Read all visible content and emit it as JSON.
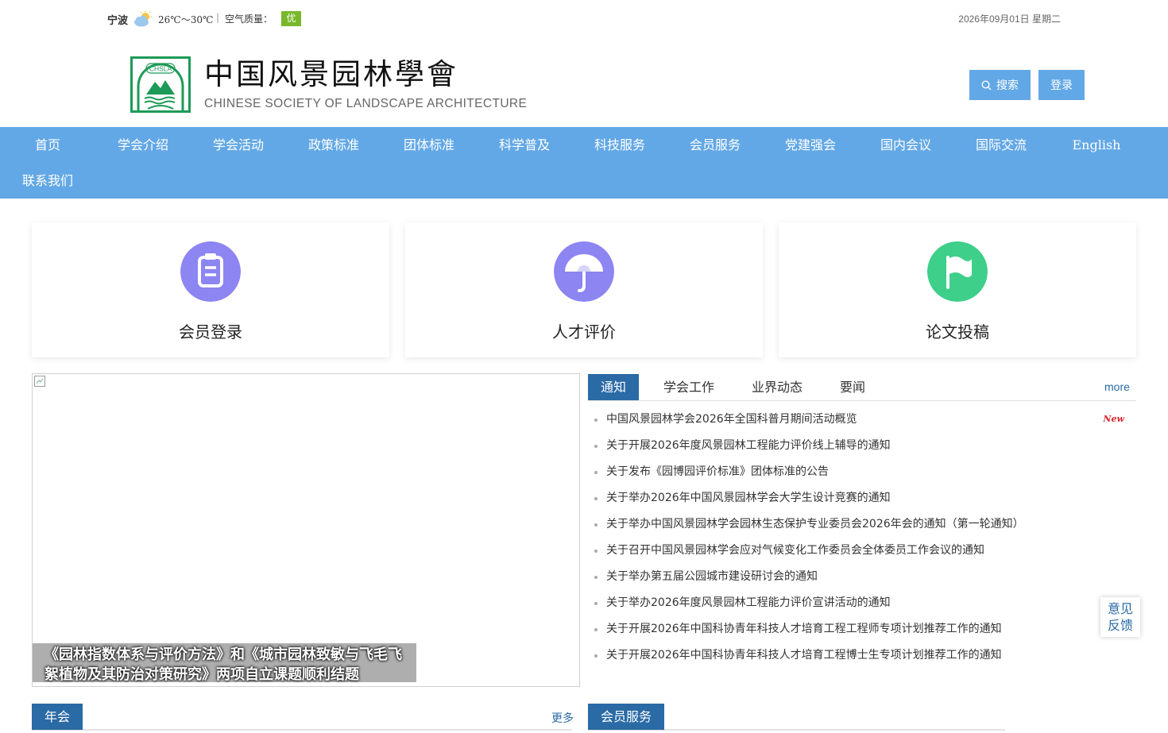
{
  "topbar": {
    "city": "宁波",
    "temperature": "26℃～30℃",
    "separator": "|",
    "air_quality_label": "空气质量：",
    "air_quality_value": "优",
    "date": "2026年09月01日 星期二",
    "weather_icon": "partly-cloudy-icon"
  },
  "header": {
    "logo_cn": "中国风景园林學會",
    "logo_en": "CHINESE SOCIETY OF LANDSCAPE ARCHITECTURE",
    "emblem_text": "CHSLA",
    "search_label": "搜索",
    "login_label": "登录"
  },
  "nav": {
    "items": [
      {
        "label": "首页"
      },
      {
        "label": "学会介绍"
      },
      {
        "label": "学会活动"
      },
      {
        "label": "政策标准"
      },
      {
        "label": "团体标准"
      },
      {
        "label": "科学普及"
      },
      {
        "label": "科技服务"
      },
      {
        "label": "会员服务"
      },
      {
        "label": "党建强会"
      },
      {
        "label": "国内会议"
      },
      {
        "label": "国际交流"
      },
      {
        "label": "English"
      },
      {
        "label": "联系我们"
      }
    ]
  },
  "cards": [
    {
      "label": "会员登录",
      "icon": "clipboard-icon",
      "color": "#8c85f2"
    },
    {
      "label": "人才评价",
      "icon": "umbrella-icon",
      "color": "#8c85f2"
    },
    {
      "label": "论文投稿",
      "icon": "flag-icon",
      "color": "#3ecf8a"
    }
  ],
  "slideshow": {
    "caption": "《园林指数体系与评价方法》和《城市园林致敏与飞毛飞絮植物及其防治对策研究》两项自立课题顺利结题"
  },
  "news": {
    "tabs": [
      {
        "label": "通知"
      },
      {
        "label": "学会工作"
      },
      {
        "label": "业界动态"
      },
      {
        "label": "要闻"
      }
    ],
    "more_label": "more",
    "new_badge": "New",
    "items": [
      {
        "title": "中国风景园林学会2026年全国科普月期间活动概览"
      },
      {
        "title": "关于开展2026年度风景园林工程能力评价线上辅导的通知"
      },
      {
        "title": "关于发布《园博园评价标准》团体标准的公告"
      },
      {
        "title": "关于举办2026年中国风景园林学会大学生设计竞赛的通知"
      },
      {
        "title": "关于举办中国风景园林学会园林生态保护专业委员会2026年会的通知（第一轮通知）"
      },
      {
        "title": "关于召开中国风景园林学会应对气候变化工作委员会全体委员工作会议的通知"
      },
      {
        "title": "关于举办第五届公园城市建设研讨会的通知"
      },
      {
        "title": "关于举办2026年度风景园林工程能力评价宣讲活动的通知"
      },
      {
        "title": "关于开展2026年中国科协青年科技人才培育工程工程师专项计划推荐工作的通知"
      },
      {
        "title": "关于开展2026年中国科协青年科技人才培育工程博士生专项计划推荐工作的通知"
      }
    ]
  },
  "feedback": {
    "line1": "意见",
    "line2": "反馈"
  },
  "sections": {
    "annual_meeting": "年会",
    "annual_more": "更多",
    "member_service": "会员服务"
  },
  "colors": {
    "nav_bg": "#63a8e6",
    "accent": "#2a6aa5",
    "air_good": "#78b82a",
    "new_red": "#d9282a"
  }
}
